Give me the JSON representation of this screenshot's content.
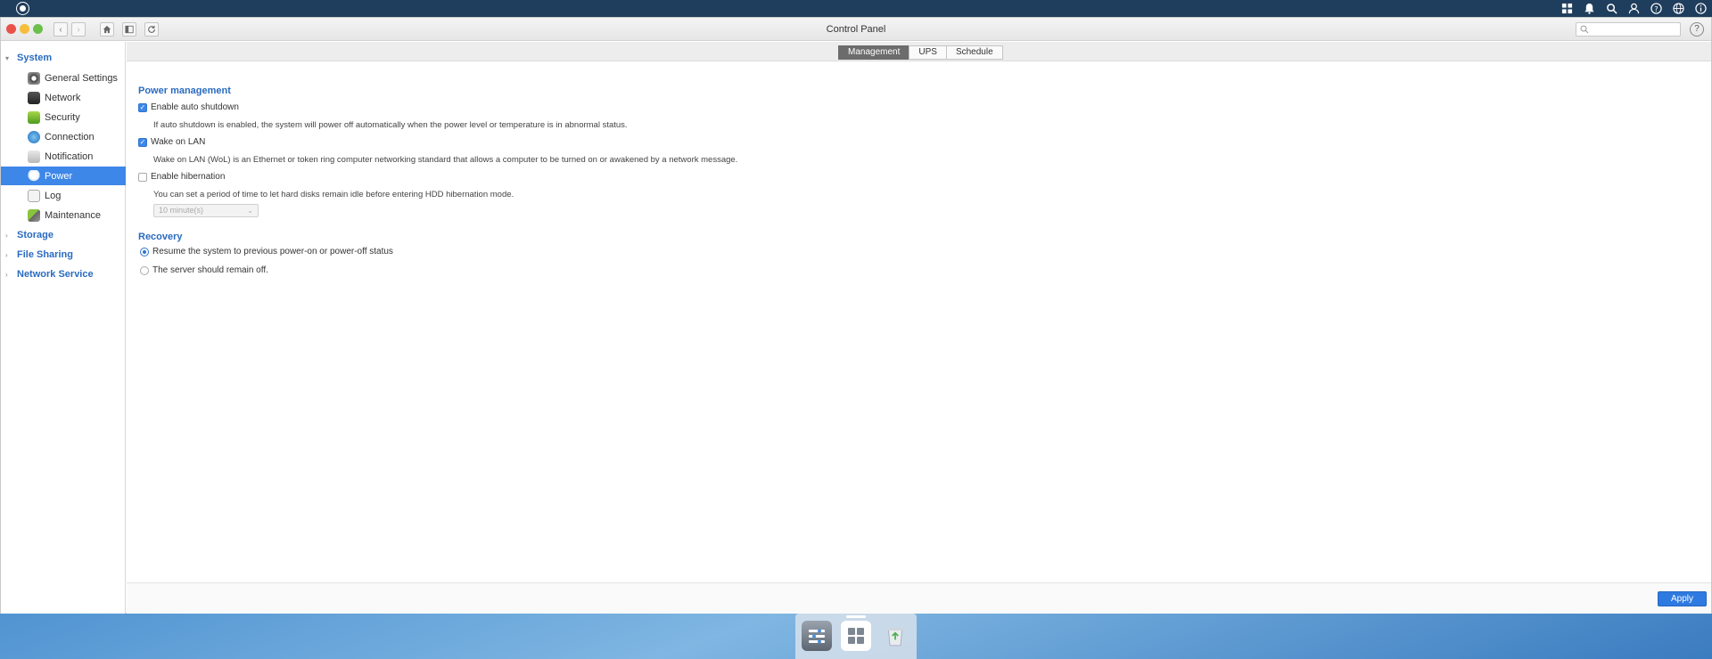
{
  "window": {
    "title": "Control Panel",
    "search_placeholder": ""
  },
  "sidebar": {
    "groups": [
      {
        "label": "System"
      },
      {
        "label": "Storage"
      },
      {
        "label": "File Sharing"
      },
      {
        "label": "Network Service"
      }
    ],
    "items": [
      {
        "label": "General Settings",
        "icon": "gear-icon"
      },
      {
        "label": "Network",
        "icon": "network-icon"
      },
      {
        "label": "Security",
        "icon": "lock-icon"
      },
      {
        "label": "Connection",
        "icon": "globe-icon"
      },
      {
        "label": "Notification",
        "icon": "bell-icon"
      },
      {
        "label": "Power",
        "icon": "lightbulb-icon",
        "active": true
      },
      {
        "label": "Log",
        "icon": "log-icon"
      },
      {
        "label": "Maintenance",
        "icon": "tools-icon"
      }
    ]
  },
  "tabs": [
    {
      "label": "Management",
      "active": true
    },
    {
      "label": "UPS"
    },
    {
      "label": "Schedule"
    }
  ],
  "power_management": {
    "title": "Power management",
    "auto_shutdown": {
      "label": "Enable auto shutdown",
      "checked": true,
      "desc": "If auto shutdown is enabled, the system will power off automatically when the power level or temperature is in abnormal status."
    },
    "wol": {
      "label": "Wake on LAN",
      "checked": true,
      "desc": "Wake on LAN (WoL) is an Ethernet or token ring computer networking standard that allows a computer to be turned on or awakened by a network message."
    },
    "hibernation": {
      "label": "Enable hibernation",
      "checked": false,
      "desc": "You can set a period of time to let hard disks remain idle before entering HDD hibernation mode.",
      "select_value": "10 minute(s)"
    }
  },
  "recovery": {
    "title": "Recovery",
    "options": [
      {
        "label": "Resume the system to previous power-on or power-off status",
        "checked": true
      },
      {
        "label": "The server should remain off.",
        "checked": false
      }
    ]
  },
  "footer": {
    "apply_label": "Apply"
  },
  "colors": {
    "accent": "#3d87e8",
    "section_title": "#2a6bc0",
    "topbar": "#1f3d5c"
  }
}
